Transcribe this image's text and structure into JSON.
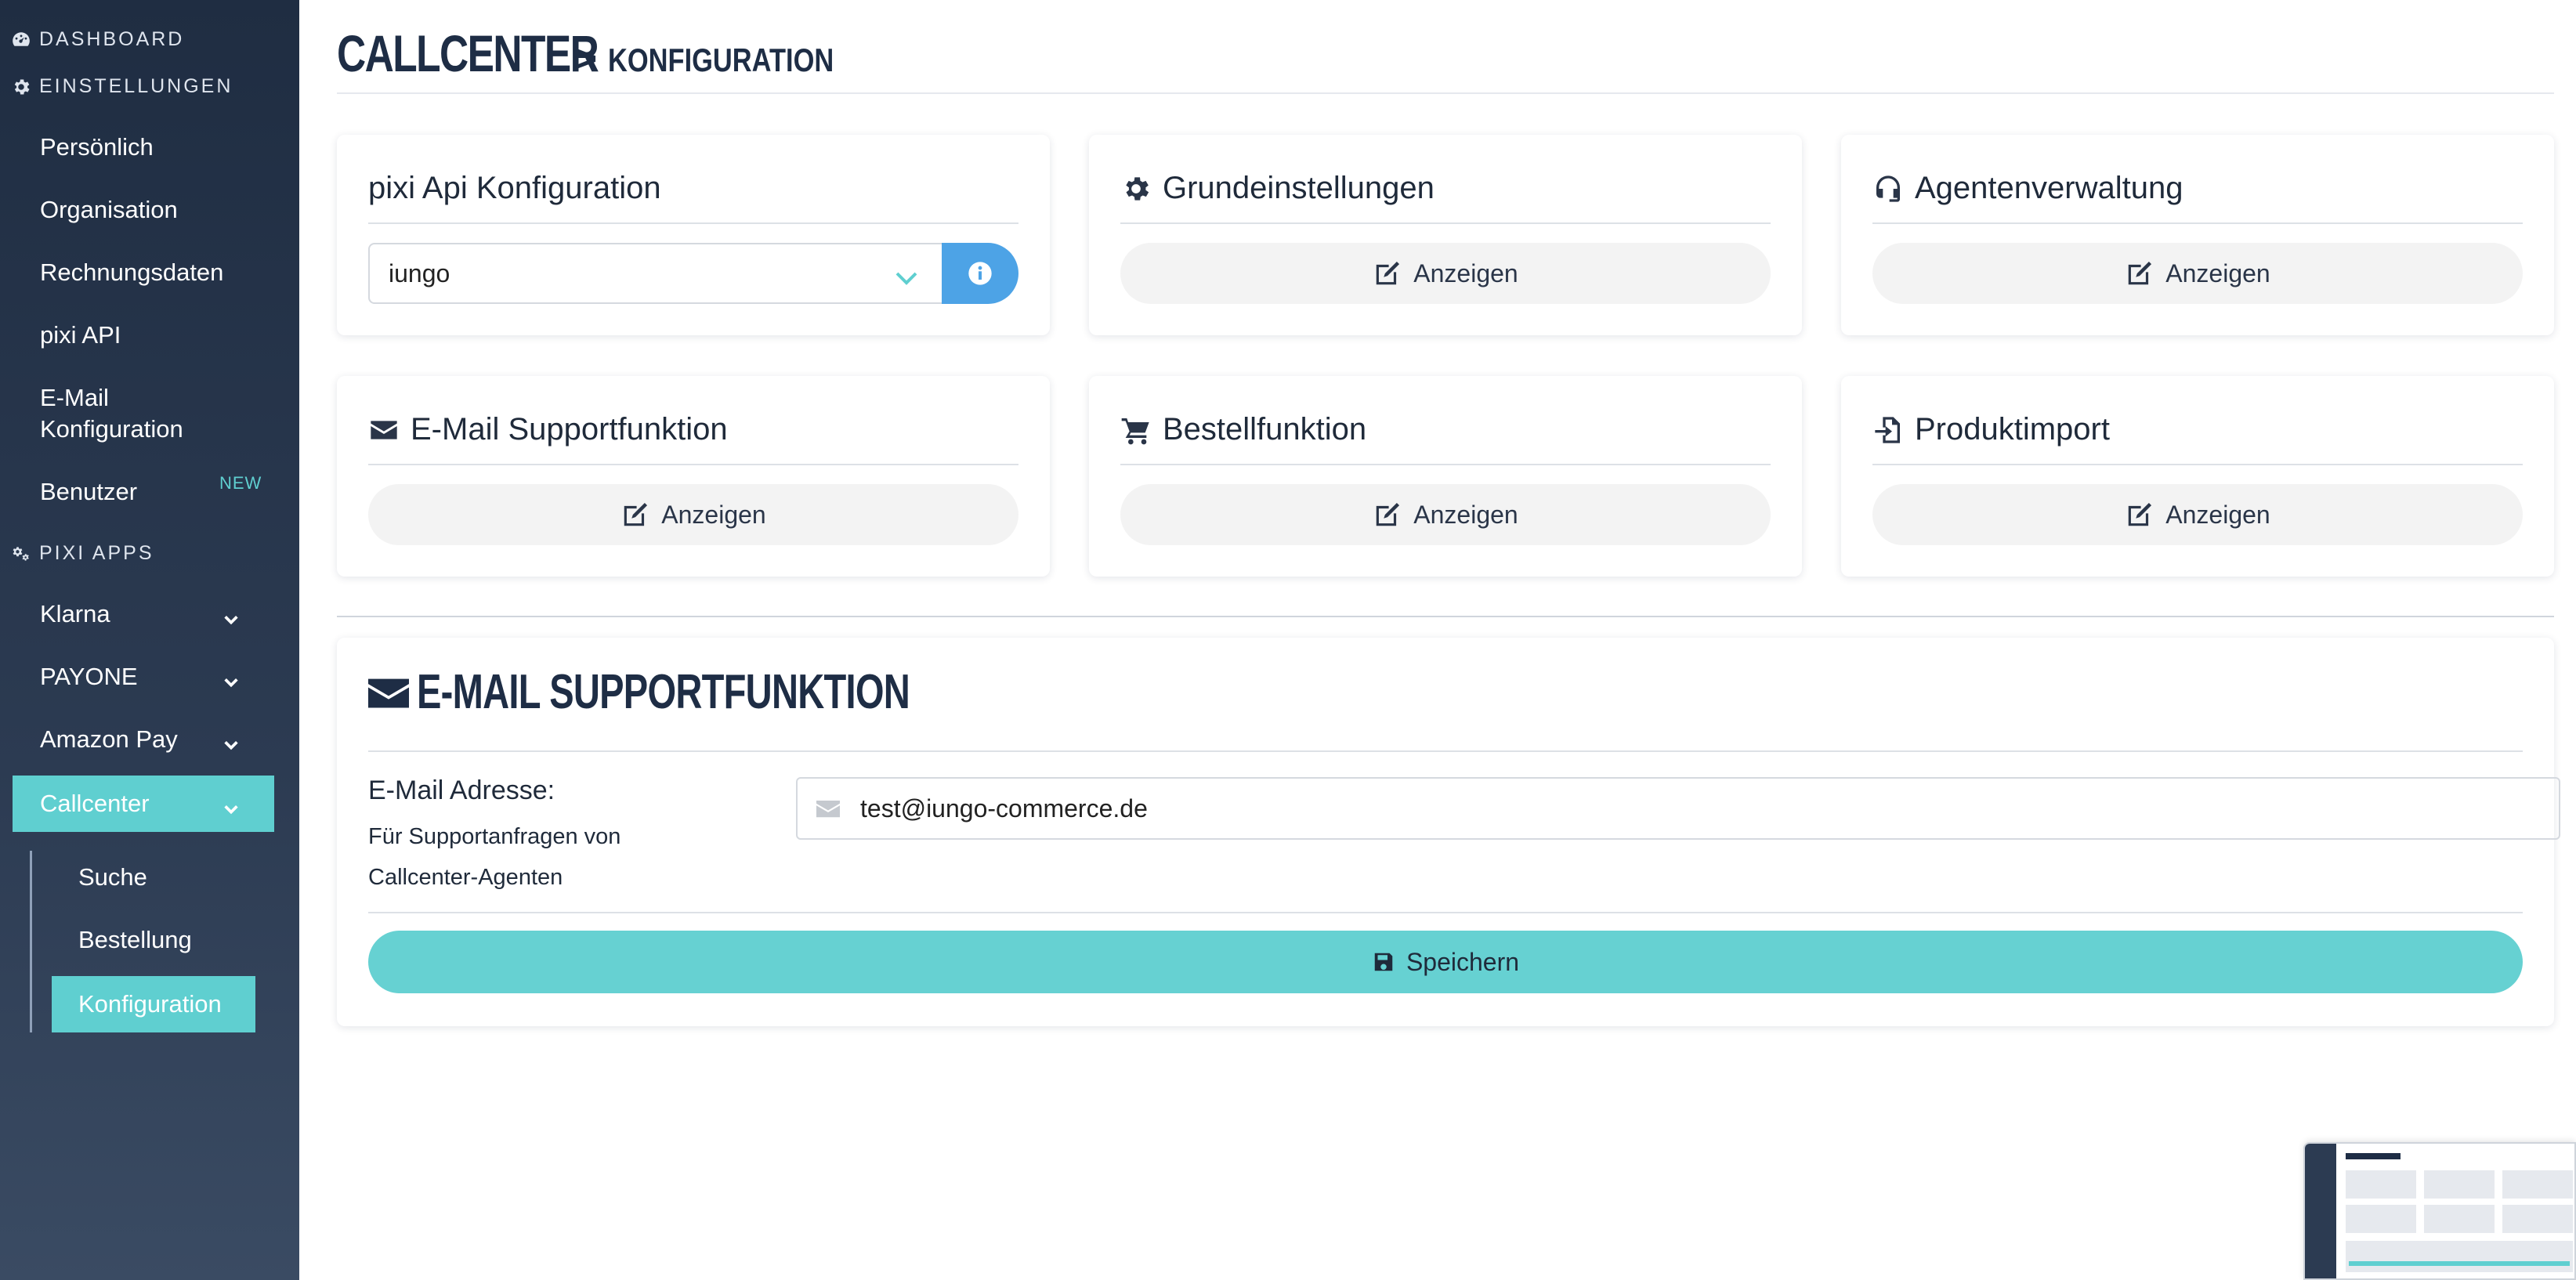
{
  "sidebar": {
    "sections": {
      "dashboard": "DASHBOARD",
      "einstellungen": "EINSTELLUNGEN",
      "pixi_apps": "PIXI APPS"
    },
    "settings_items": [
      {
        "label": "Persönlich"
      },
      {
        "label": "Organisation"
      },
      {
        "label": "Rechnungsdaten"
      },
      {
        "label": "pixi API"
      },
      {
        "label": "E-Mail Konfiguration"
      },
      {
        "label": "Benutzer",
        "badge": "NEW"
      }
    ],
    "apps": [
      {
        "label": "Klarna"
      },
      {
        "label": "PAYONE"
      },
      {
        "label": "Amazon Pay"
      },
      {
        "label": "Callcenter",
        "active": true
      }
    ],
    "callcenter_sub": [
      {
        "label": "Suche"
      },
      {
        "label": "Bestellung"
      },
      {
        "label": "Konfiguration",
        "active": true
      }
    ]
  },
  "page": {
    "title": "CALLCENTER",
    "separator": ">",
    "subtitle": "KONFIGURATION"
  },
  "cards": {
    "api": {
      "title": "pixi Api Konfiguration",
      "selected": "iungo"
    },
    "grund": {
      "title": "Grundeinstellungen",
      "button": "Anzeigen"
    },
    "agent": {
      "title": "Agentenverwaltung",
      "button": "Anzeigen"
    },
    "email": {
      "title": "E-Mail Supportfunktion",
      "button": "Anzeigen"
    },
    "bestell": {
      "title": "Bestellfunktion",
      "button": "Anzeigen"
    },
    "import": {
      "title": "Produktimport",
      "button": "Anzeigen"
    }
  },
  "email_panel": {
    "title": "E-MAIL SUPPORTFUNKTION",
    "label": "E-Mail Adresse:",
    "help": "Für Supportanfragen von Callcenter-Agenten",
    "value": "test@iungo-commerce.de",
    "save": "Speichern"
  },
  "colors": {
    "sidebar_bg": "#2c3b52",
    "accent": "#5fcfd0",
    "info": "#4da3e6",
    "heading": "#1e2d45"
  }
}
